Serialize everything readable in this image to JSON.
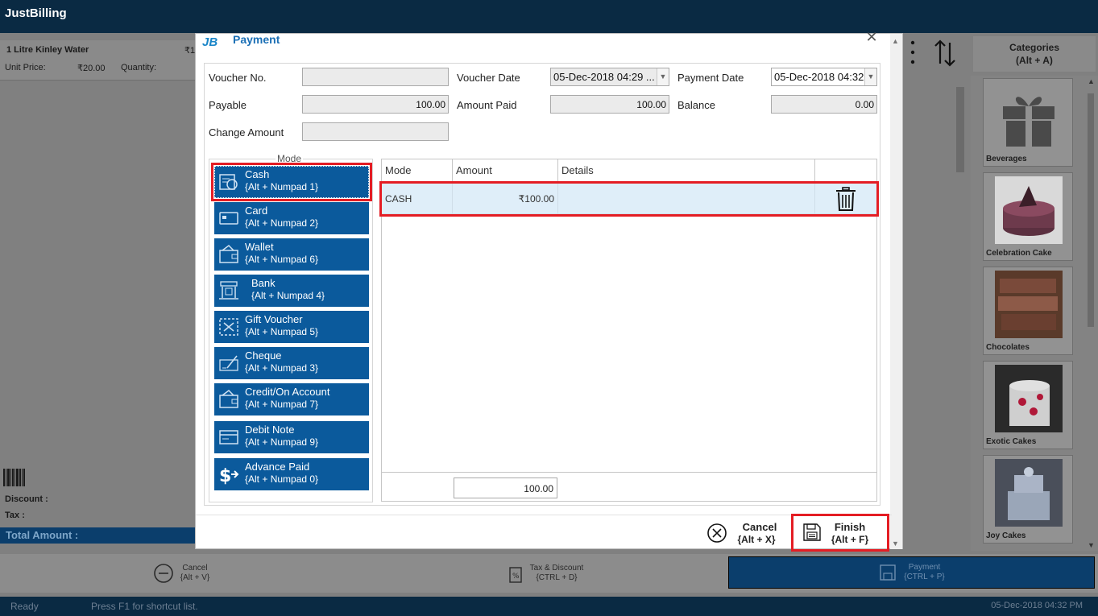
{
  "app": {
    "logo": "JustBilling",
    "cart": {
      "item_name": "1 Litre Kinley Water",
      "unit_price_label": "Unit Price:",
      "unit_price_value": "₹20.00",
      "quantity_label": "Quantity:",
      "price_cut": "₹1"
    },
    "summary": {
      "discount_label": "Discount :",
      "tax_label": "Tax :",
      "total_label": "Total Amount :"
    },
    "bottom_actions": {
      "cancel_label": "Cancel",
      "cancel_shortcut": "{Alt + V}",
      "tax_label": "Tax & Discount",
      "tax_shortcut": "{CTRL + D}",
      "payment_label": "Payment",
      "payment_shortcut": "{CTRL + P}"
    },
    "categories": {
      "title": "Categories",
      "shortcut": "(Alt + A)",
      "items": [
        "Beverages",
        "Celebration Cake",
        "Chocolates",
        "Exotic Cakes",
        "Joy Cakes"
      ]
    },
    "status": {
      "ready": "Ready",
      "hint": "Press F1 for shortcut list.",
      "datetime": "05-Dec-2018 04:32 PM"
    }
  },
  "dialog": {
    "logo": "JB",
    "title": "Payment",
    "fields": {
      "voucher_no_label": "Voucher No.",
      "voucher_no_value": "",
      "voucher_date_label": "Voucher Date",
      "voucher_date_value": "05-Dec-2018 04:29 ...",
      "payment_date_label": "Payment Date",
      "payment_date_value": "05-Dec-2018 04:32",
      "payable_label": "Payable",
      "payable_value": "100.00",
      "amount_paid_label": "Amount Paid",
      "amount_paid_value": "100.00",
      "balance_label": "Balance",
      "balance_value": "0.00",
      "change_amount_label": "Change Amount",
      "change_amount_value": ""
    },
    "mode_legend": "Mode",
    "modes": [
      {
        "label": "Cash",
        "shortcut": "{Alt + Numpad 1}",
        "icon": "cash-icon"
      },
      {
        "label": "Card",
        "shortcut": "{Alt + Numpad 2}",
        "icon": "card-icon"
      },
      {
        "label": "Wallet",
        "shortcut": "{Alt + Numpad 6}",
        "icon": "wallet-icon"
      },
      {
        "label": "Bank",
        "shortcut": "{Alt + Numpad 4}",
        "icon": "bank-icon"
      },
      {
        "label": "Gift Voucher",
        "shortcut": "{Alt + Numpad 5}",
        "icon": "gift-voucher-icon"
      },
      {
        "label": "Cheque",
        "shortcut": "{Alt + Numpad 3}",
        "icon": "cheque-icon"
      },
      {
        "label": "Credit/On Account",
        "shortcut": "{Alt + Numpad 7}",
        "icon": "credit-icon"
      },
      {
        "label": "Debit Note",
        "shortcut": "{Alt + Numpad 9}",
        "icon": "debit-note-icon"
      },
      {
        "label": "Advance Paid",
        "shortcut": "{Alt + Numpad 0}",
        "icon": "advance-paid-icon"
      }
    ],
    "grid": {
      "headers": [
        "Mode",
        "Amount",
        "Details"
      ],
      "rows": [
        {
          "mode": "CASH",
          "amount": "₹100.00",
          "details": ""
        }
      ],
      "total": "100.00"
    },
    "footer": {
      "cancel_label": "Cancel",
      "cancel_shortcut": "{Alt + X}",
      "finish_label": "Finish",
      "finish_shortcut": "{Alt + F}"
    },
    "colors": {
      "mode_button": "#0b5a9c",
      "highlight": "#e41d24",
      "title": "#1b6fb5"
    }
  }
}
